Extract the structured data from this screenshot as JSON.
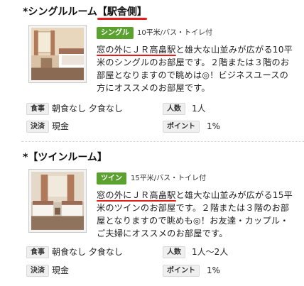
{
  "rooms": [
    {
      "title_prefix": "*シングルルーム",
      "title_highlight": "【駅舎側】",
      "tag": "シングル",
      "spec": "10平米/バス・トイレ付",
      "desc_underlined": "窓の外にＪＲ高畠駅",
      "desc_rest": "と雄大な山並みが広がる10平米のシングルのお部屋です。２階または３階のお部屋となりますので眺めは◎！ビジネスユースの方にオススメのお部屋です。",
      "meal_label": "食事",
      "meal_value": "朝食なし 夕食なし",
      "people_label": "人数",
      "people_value": "1人",
      "payment_label": "決済",
      "payment_value": "現金",
      "point_label": "ポイント",
      "point_value": "1%"
    },
    {
      "title_prefix": "*【ツインルーム】",
      "title_highlight": "",
      "tag": "ツイン",
      "spec": "15平米/バス・トイレ付",
      "desc_underlined": "窓の外にＪＲ高畠駅",
      "desc_rest": "と雄大な山並みが広がる15平米のツインのお部屋です。２階または３階のお部屋となりますので眺めも◎！お友達・カップル・ご夫婦にオススメのお部屋です。",
      "meal_label": "食事",
      "meal_value": "朝食なし 夕食なし",
      "people_label": "人数",
      "people_value": "1人～2人",
      "payment_label": "決済",
      "payment_value": "現金",
      "point_label": "ポイント",
      "point_value": "1%"
    }
  ]
}
